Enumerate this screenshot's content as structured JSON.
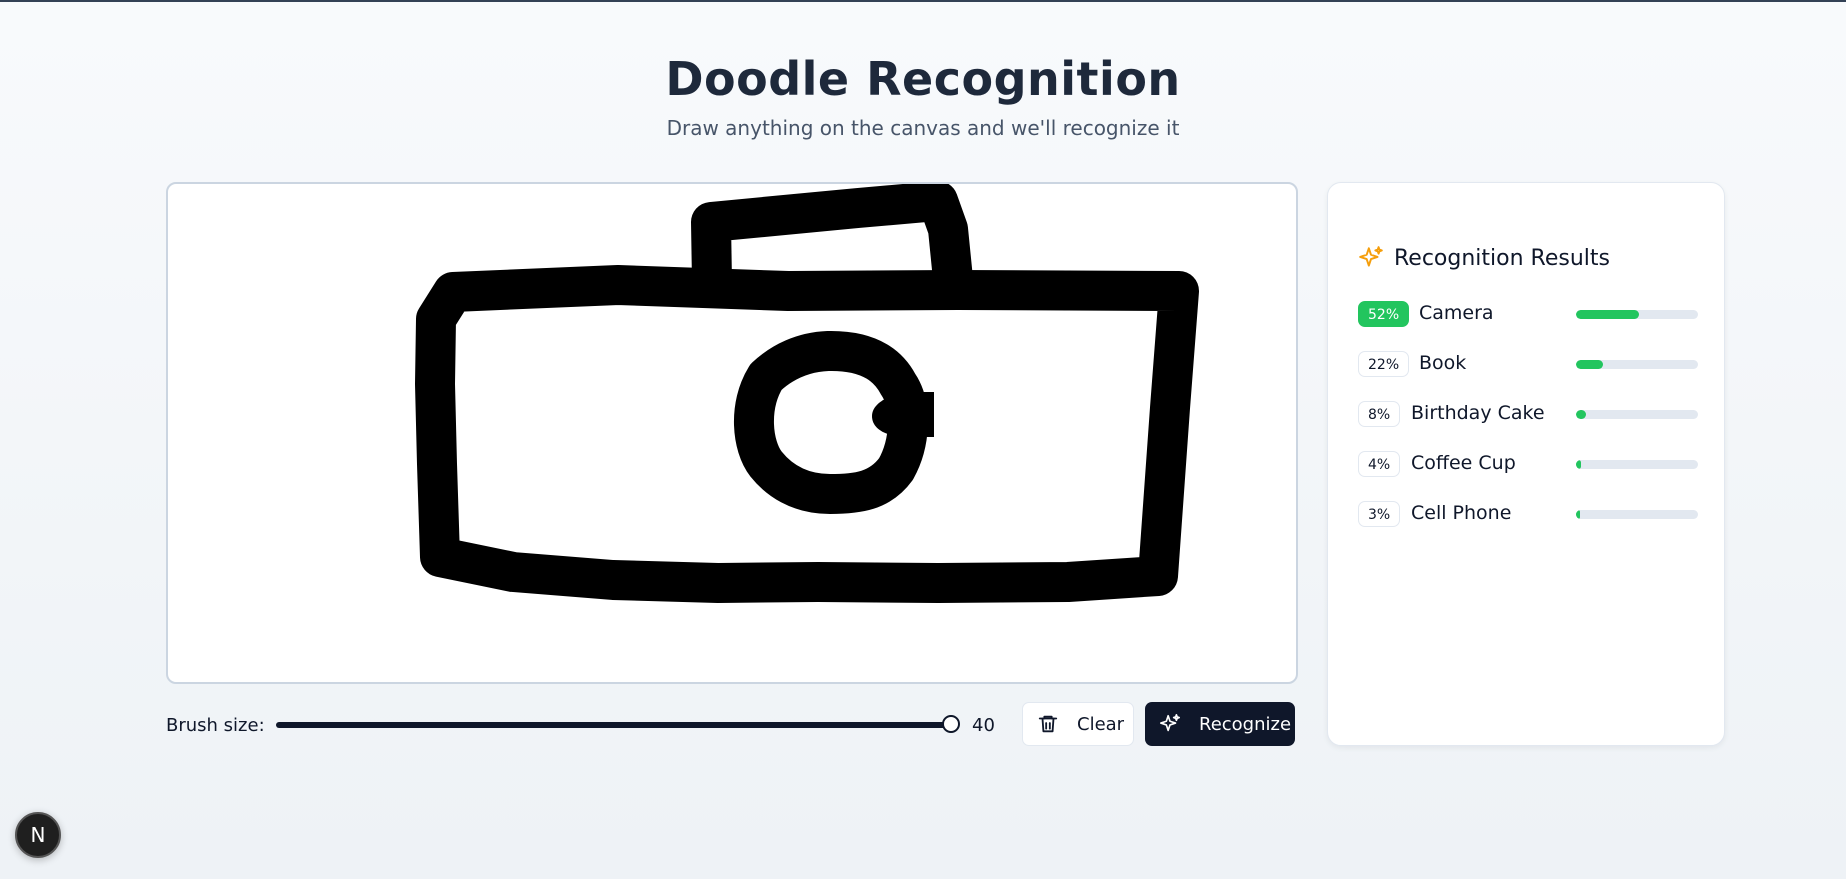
{
  "header": {
    "title": "Doodle Recognition",
    "subtitle": "Draw anything on the canvas and we'll recognize it"
  },
  "controls": {
    "brush_label": "Brush size:",
    "brush_value": "40",
    "brush_min": 1,
    "brush_max": 40,
    "clear_label": "Clear",
    "recognize_label": "Recognize"
  },
  "results": {
    "title": "Recognition Results",
    "items": [
      {
        "percent_text": "52%",
        "label": "Camera",
        "value": 0.52
      },
      {
        "percent_text": "22%",
        "label": "Book",
        "value": 0.22
      },
      {
        "percent_text": "8%",
        "label": "Birthday Cake",
        "value": 0.08
      },
      {
        "percent_text": "4%",
        "label": "Coffee Cup",
        "value": 0.04
      },
      {
        "percent_text": "3%",
        "label": "Cell Phone",
        "value": 0.03
      }
    ]
  },
  "badge": {
    "letter": "N"
  },
  "colors": {
    "accent": "#22c55e",
    "dark": "#0f172a",
    "sparkle": "#f59e0b",
    "track": "#e2e8f0"
  },
  "icons": {
    "clear": "trash-icon",
    "recognize": "sparkles-icon",
    "results": "sparkles-icon"
  }
}
